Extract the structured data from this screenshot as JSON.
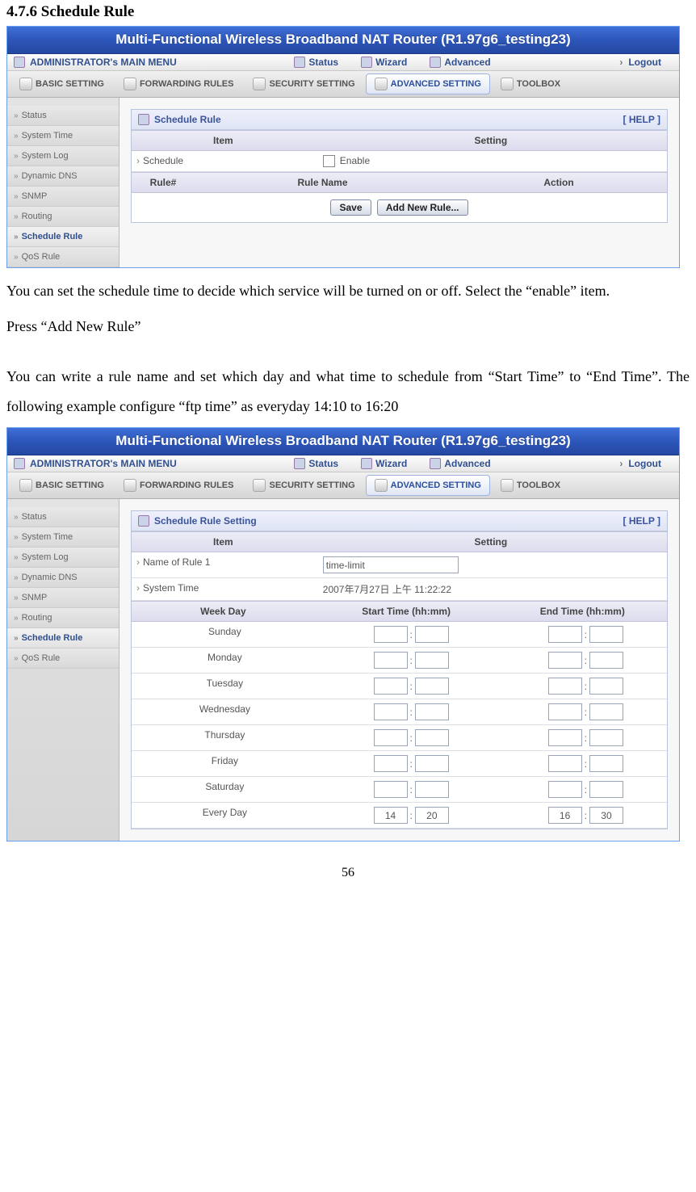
{
  "heading": "4.7.6 Schedule Rule",
  "paragraph1": "You can set the schedule time to decide which service will be turned on or off. Select the “enable” item.",
  "paragraph2": "Press “Add New Rule”",
  "paragraph3": "You can write a rule name and set which day and what time to schedule from “Start Time” to “End Time”. The following example configure “ftp time” as everyday 14:10 to 16:20",
  "page_number": "56",
  "banner": "Multi-Functional Wireless Broadband NAT Router (R1.97g6_testing23)",
  "topbar": {
    "menu": "ADMINISTRATOR's MAIN MENU",
    "status": "Status",
    "wizard": "Wizard",
    "advanced": "Advanced",
    "logout": "Logout"
  },
  "subbar": {
    "basic": "BASIC SETTING",
    "forward": "FORWARDING RULES",
    "security": "SECURITY SETTING",
    "advanced": "ADVANCED SETTING",
    "toolbox": "TOOLBOX"
  },
  "sidebar": [
    "Status",
    "System Time",
    "System Log",
    "Dynamic DNS",
    "SNMP",
    "Routing",
    "Schedule Rule",
    "QoS Rule"
  ],
  "screen1": {
    "panel_title": "Schedule Rule",
    "help": "[ HELP ]",
    "col_item": "Item",
    "col_setting": "Setting",
    "row_schedule": "Schedule",
    "row_enable": "Enable",
    "col_rule_no": "Rule#",
    "col_rule_name": "Rule Name",
    "col_action": "Action",
    "btn_save": "Save",
    "btn_add": "Add New Rule..."
  },
  "screen2": {
    "panel_title": "Schedule Rule Setting",
    "help": "[ HELP ]",
    "col_item": "Item",
    "col_setting": "Setting",
    "row_name_label": "Name of Rule 1",
    "row_name_value": "time-limit",
    "row_systime_label": "System Time",
    "row_systime_value": "2007年7月27日 上午 11:22:22",
    "col_weekday": "Week Day",
    "col_start": "Start Time (hh:mm)",
    "col_end": "End Time (hh:mm)",
    "days": [
      "Sunday",
      "Monday",
      "Tuesday",
      "Wednesday",
      "Thursday",
      "Friday",
      "Saturday",
      "Every Day"
    ],
    "times": [
      {
        "sh": "",
        "sm": "",
        "eh": "",
        "em": ""
      },
      {
        "sh": "",
        "sm": "",
        "eh": "",
        "em": ""
      },
      {
        "sh": "",
        "sm": "",
        "eh": "",
        "em": ""
      },
      {
        "sh": "",
        "sm": "",
        "eh": "",
        "em": ""
      },
      {
        "sh": "",
        "sm": "",
        "eh": "",
        "em": ""
      },
      {
        "sh": "",
        "sm": "",
        "eh": "",
        "em": ""
      },
      {
        "sh": "",
        "sm": "",
        "eh": "",
        "em": ""
      },
      {
        "sh": "14",
        "sm": "20",
        "eh": "16",
        "em": "30"
      }
    ]
  }
}
